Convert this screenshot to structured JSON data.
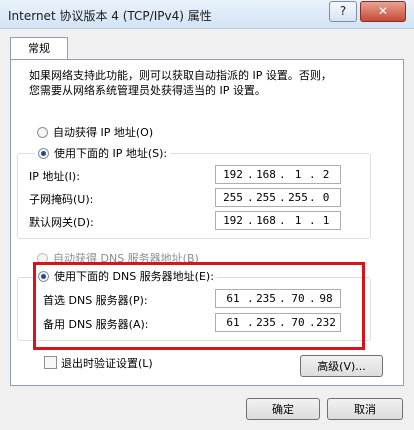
{
  "window": {
    "title": "Internet 协议版本 4 (TCP/IPv4) 属性",
    "help_label": "?",
    "close_label": "✕"
  },
  "tab": {
    "label": "常规"
  },
  "description": {
    "line1": "如果网络支持此功能，则可以获取自动指派的 IP 设置。否则，",
    "line2": "您需要从网络系统管理员处获得适当的 IP 设置。"
  },
  "ip_section": {
    "auto_label": "自动获得 IP 地址(O)",
    "manual_label": "使用下面的 IP 地址(S):",
    "selected": "manual",
    "fields": [
      {
        "label": "IP 地址(I):",
        "octets": [
          "192",
          "168",
          "1",
          "2"
        ]
      },
      {
        "label": "子网掩码(U):",
        "octets": [
          "255",
          "255",
          "255",
          "0"
        ]
      },
      {
        "label": "默认网关(D):",
        "octets": [
          "192",
          "168",
          "1",
          "1"
        ]
      }
    ]
  },
  "dns_section": {
    "auto_label": "自动获得 DNS 服务器地址(B)",
    "manual_label": "使用下面的 DNS 服务器地址(E):",
    "selected": "manual",
    "fields": [
      {
        "label": "首选 DNS 服务器(P):",
        "octets": [
          "61",
          "235",
          "70",
          "98"
        ]
      },
      {
        "label": "备用 DNS 服务器(A):",
        "octets": [
          "61",
          "235",
          "70",
          "232"
        ]
      }
    ]
  },
  "validate_on_exit": {
    "label": "退出时验证设置(L)",
    "checked": false
  },
  "buttons": {
    "advanced": "高级(V)...",
    "ok": "确定",
    "cancel": "取消"
  },
  "highlight_color": "#d8141b"
}
